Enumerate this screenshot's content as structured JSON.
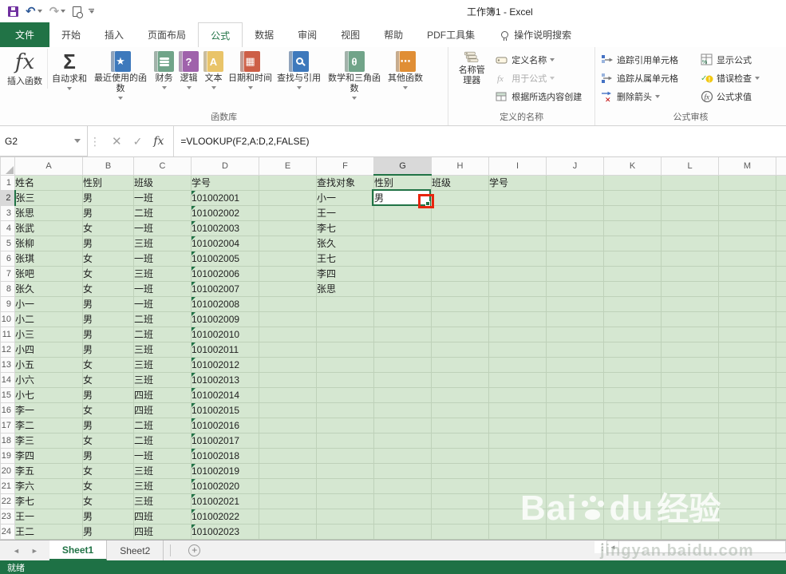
{
  "window": {
    "title": "工作簿1 - Excel"
  },
  "qat": {
    "icons": [
      {
        "name": "save-icon"
      },
      {
        "name": "undo-icon",
        "glyph": "↶"
      },
      {
        "name": "redo-icon",
        "glyph": "↷"
      },
      {
        "name": "print-preview-icon"
      },
      {
        "name": "customize-qat-icon"
      }
    ]
  },
  "ribbon": {
    "tabs": [
      {
        "label": "文件",
        "file": true
      },
      {
        "label": "开始"
      },
      {
        "label": "插入"
      },
      {
        "label": "页面布局"
      },
      {
        "label": "公式",
        "active": true
      },
      {
        "label": "数据"
      },
      {
        "label": "审阅"
      },
      {
        "label": "视图"
      },
      {
        "label": "帮助"
      },
      {
        "label": "PDF工具集"
      }
    ],
    "search_label": "操作说明搜索",
    "insert_function_label": "插入函数",
    "function_library": {
      "group_label": "函数库",
      "buttons": [
        {
          "label": "自动求和",
          "icon": "sigma-icon",
          "glyph": "Σ",
          "color": "",
          "caret": true
        },
        {
          "label": "最近使用的函数",
          "icon": "recent-functions-book-icon",
          "glyph": "★",
          "color": "#3E79BC",
          "caret": true
        },
        {
          "label": "财务",
          "icon": "financial-book-icon",
          "glyph": "coins",
          "color": "#71A489",
          "caret": true
        },
        {
          "label": "逻辑",
          "icon": "logical-book-icon",
          "glyph": "?",
          "color": "#9F62AB",
          "caret": true
        },
        {
          "label": "文本",
          "icon": "text-book-icon",
          "glyph": "A",
          "color": "#E9C469",
          "caret": true
        },
        {
          "label": "日期和时间",
          "icon": "date-time-book-icon",
          "glyph": "▦",
          "color": "#CD5F47",
          "caret": true
        },
        {
          "label": "查找与引用",
          "icon": "lookup-reference-book-icon",
          "glyph": "mag",
          "color": "#3E79BC",
          "caret": true
        },
        {
          "label": "数学和三角函数",
          "icon": "math-trig-book-icon",
          "glyph": "θ",
          "color": "#71A489",
          "caret": true
        },
        {
          "label": "其他函数",
          "icon": "more-functions-book-icon",
          "glyph": "⋯",
          "color": "#E08E35",
          "caret": true
        }
      ]
    },
    "defined_names": {
      "group_label": "定义的名称",
      "name_manager_label": "名称管理器",
      "items": [
        {
          "label": "定义名称",
          "caret": true
        },
        {
          "label": "用于公式",
          "caret": true,
          "disabled": true
        },
        {
          "label": "根据所选内容创建"
        }
      ]
    },
    "formula_auditing": {
      "group_label": "公式审核",
      "items_left": [
        {
          "label": "追踪引用单元格"
        },
        {
          "label": "追踪从属单元格"
        },
        {
          "label": "删除箭头",
          "caret": true
        }
      ],
      "items_right": [
        {
          "label": "显示公式"
        },
        {
          "label": "错误检查",
          "caret": true
        },
        {
          "label": "公式求值"
        }
      ]
    }
  },
  "formula_bar": {
    "name_box": "G2",
    "formula": "=VLOOKUP(F2,A:D,2,FALSE)"
  },
  "grid": {
    "columns": [
      "A",
      "B",
      "C",
      "D",
      "E",
      "F",
      "G",
      "H",
      "I",
      "J",
      "K",
      "L",
      "M"
    ],
    "selected_cell": "G2",
    "selected_column": "G",
    "selected_row": 2,
    "rows": [
      {
        "n": 1,
        "A": "姓名",
        "B": "性别",
        "C": "班级",
        "D": "学号",
        "F": "查找对象",
        "G": "性别",
        "H": "班级",
        "I": "学号"
      },
      {
        "n": 2,
        "A": "张三",
        "B": "男",
        "C": "一班",
        "D": "101002001",
        "F": "小一",
        "G": "男"
      },
      {
        "n": 3,
        "A": "张思",
        "B": "男",
        "C": "二班",
        "D": "101002002",
        "F": "王一"
      },
      {
        "n": 4,
        "A": "张武",
        "B": "女",
        "C": "一班",
        "D": "101002003",
        "F": "李七"
      },
      {
        "n": 5,
        "A": "张柳",
        "B": "男",
        "C": "三班",
        "D": "101002004",
        "F": "张久"
      },
      {
        "n": 6,
        "A": "张琪",
        "B": "女",
        "C": "一班",
        "D": "101002005",
        "F": "王七"
      },
      {
        "n": 7,
        "A": "张吧",
        "B": "女",
        "C": "三班",
        "D": "101002006",
        "F": "李四"
      },
      {
        "n": 8,
        "A": "张久",
        "B": "女",
        "C": "一班",
        "D": "101002007",
        "F": "张思"
      },
      {
        "n": 9,
        "A": "小一",
        "B": "男",
        "C": "一班",
        "D": "101002008"
      },
      {
        "n": 10,
        "A": "小二",
        "B": "男",
        "C": "二班",
        "D": "101002009"
      },
      {
        "n": 11,
        "A": "小三",
        "B": "男",
        "C": "二班",
        "D": "101002010"
      },
      {
        "n": 12,
        "A": "小四",
        "B": "男",
        "C": "三班",
        "D": "101002011"
      },
      {
        "n": 13,
        "A": "小五",
        "B": "女",
        "C": "三班",
        "D": "101002012"
      },
      {
        "n": 14,
        "A": "小六",
        "B": "女",
        "C": "三班",
        "D": "101002013"
      },
      {
        "n": 15,
        "A": "小七",
        "B": "男",
        "C": "四班",
        "D": "101002014"
      },
      {
        "n": 16,
        "A": "李一",
        "B": "女",
        "C": "四班",
        "D": "101002015"
      },
      {
        "n": 17,
        "A": "李二",
        "B": "男",
        "C": "二班",
        "D": "101002016"
      },
      {
        "n": 18,
        "A": "李三",
        "B": "女",
        "C": "二班",
        "D": "101002017"
      },
      {
        "n": 19,
        "A": "李四",
        "B": "男",
        "C": "一班",
        "D": "101002018"
      },
      {
        "n": 20,
        "A": "李五",
        "B": "女",
        "C": "三班",
        "D": "101002019"
      },
      {
        "n": 21,
        "A": "李六",
        "B": "女",
        "C": "三班",
        "D": "101002020"
      },
      {
        "n": 22,
        "A": "李七",
        "B": "女",
        "C": "三班",
        "D": "101002021"
      },
      {
        "n": 23,
        "A": "王一",
        "B": "男",
        "C": "四班",
        "D": "101002022"
      },
      {
        "n": 24,
        "A": "王二",
        "B": "男",
        "C": "四班",
        "D": "101002023"
      }
    ]
  },
  "sheet_tabs": {
    "tabs": [
      {
        "label": "Sheet1",
        "active": true
      },
      {
        "label": "Sheet2"
      }
    ],
    "add_label": "+"
  },
  "status_bar": {
    "mode": "就绪"
  },
  "watermark": {
    "brand_prefix": "Bai",
    "brand_suffix": "du",
    "brand_cjk": "经验",
    "url": "jingyan.baidu.com"
  },
  "colors": {
    "accent_green": "#217346",
    "cell_fill": "#d5e7d1",
    "gridline": "#bed1b9",
    "annotation_red": "#e8250e",
    "status_bar_green": "#1e7145"
  }
}
